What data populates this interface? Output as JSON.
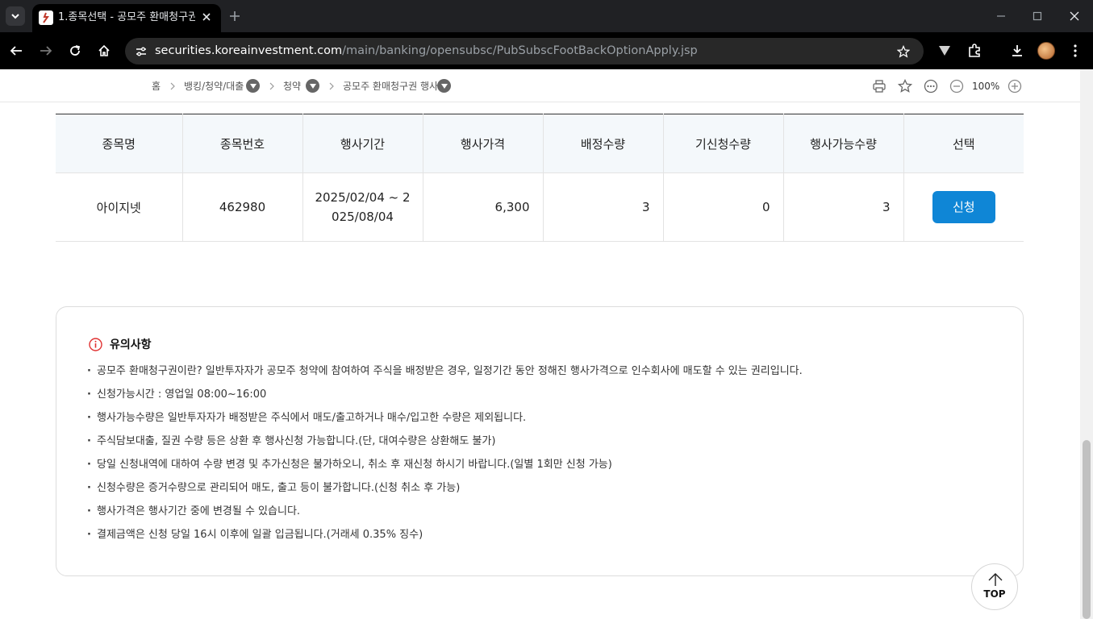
{
  "browser": {
    "tab_title": "1.종목선택 - 공모주 환매청구권",
    "url_host": "securities.koreainvestment.com",
    "url_path": "/main/banking/opensubsc/PubSubscFootBackOptionApply.jsp"
  },
  "breadcrumb": {
    "home": "홈",
    "level1": "뱅킹/청약/대출",
    "level2": "청약",
    "level3": "공모주 환매청구권 행사",
    "zoom": "100%"
  },
  "table": {
    "headers": [
      "종목명",
      "종목번호",
      "행사기간",
      "행사가격",
      "배정수량",
      "기신청수량",
      "행사가능수량",
      "선택"
    ],
    "row": {
      "name": "아이지넷",
      "code": "462980",
      "period": "2025/02/04 ~ 2025/08/04",
      "price": "6,300",
      "allotted": "3",
      "applied": "0",
      "available": "3",
      "action": "신청"
    }
  },
  "notice": {
    "title": "유의사항",
    "items": [
      "공모주 환매청구권이란? 일반투자자가 공모주 청약에 참여하여 주식을 배정받은 경우, 일정기간 동안 정해진 행사가격으로 인수회사에 매도할 수 있는 권리입니다.",
      "신청가능시간 : 영업일 08:00~16:00",
      "행사가능수량은 일반투자자가 배정받은 주식에서 매도/출고하거나 매수/입고한 수량은 제외됩니다.",
      "주식담보대출, 질권 수량 등은 상환 후 행사신청 가능합니다.(단, 대여수량은 상환해도 불가)",
      "당일 신청내역에 대하여 수량 변경 및 추가신청은 불가하오니, 취소 후 재신청 하시기 바랍니다.(일별 1회만 신청 가능)",
      "신청수량은 증거수량으로 관리되어 매도, 출고 등이 불가합니다.(신청 취소 후 가능)",
      "행사가격은 행사기간 중에 변경될 수 있습니다.",
      "결제금액은 신청 당일 16시 이후에 일괄 입금됩니다.(거래세 0.35% 징수)"
    ]
  },
  "top_button": "TOP",
  "colors": {
    "apply_button": "#0f86d6",
    "table_header_bg": "#f4f8fb",
    "notice_icon": "#e03131"
  }
}
